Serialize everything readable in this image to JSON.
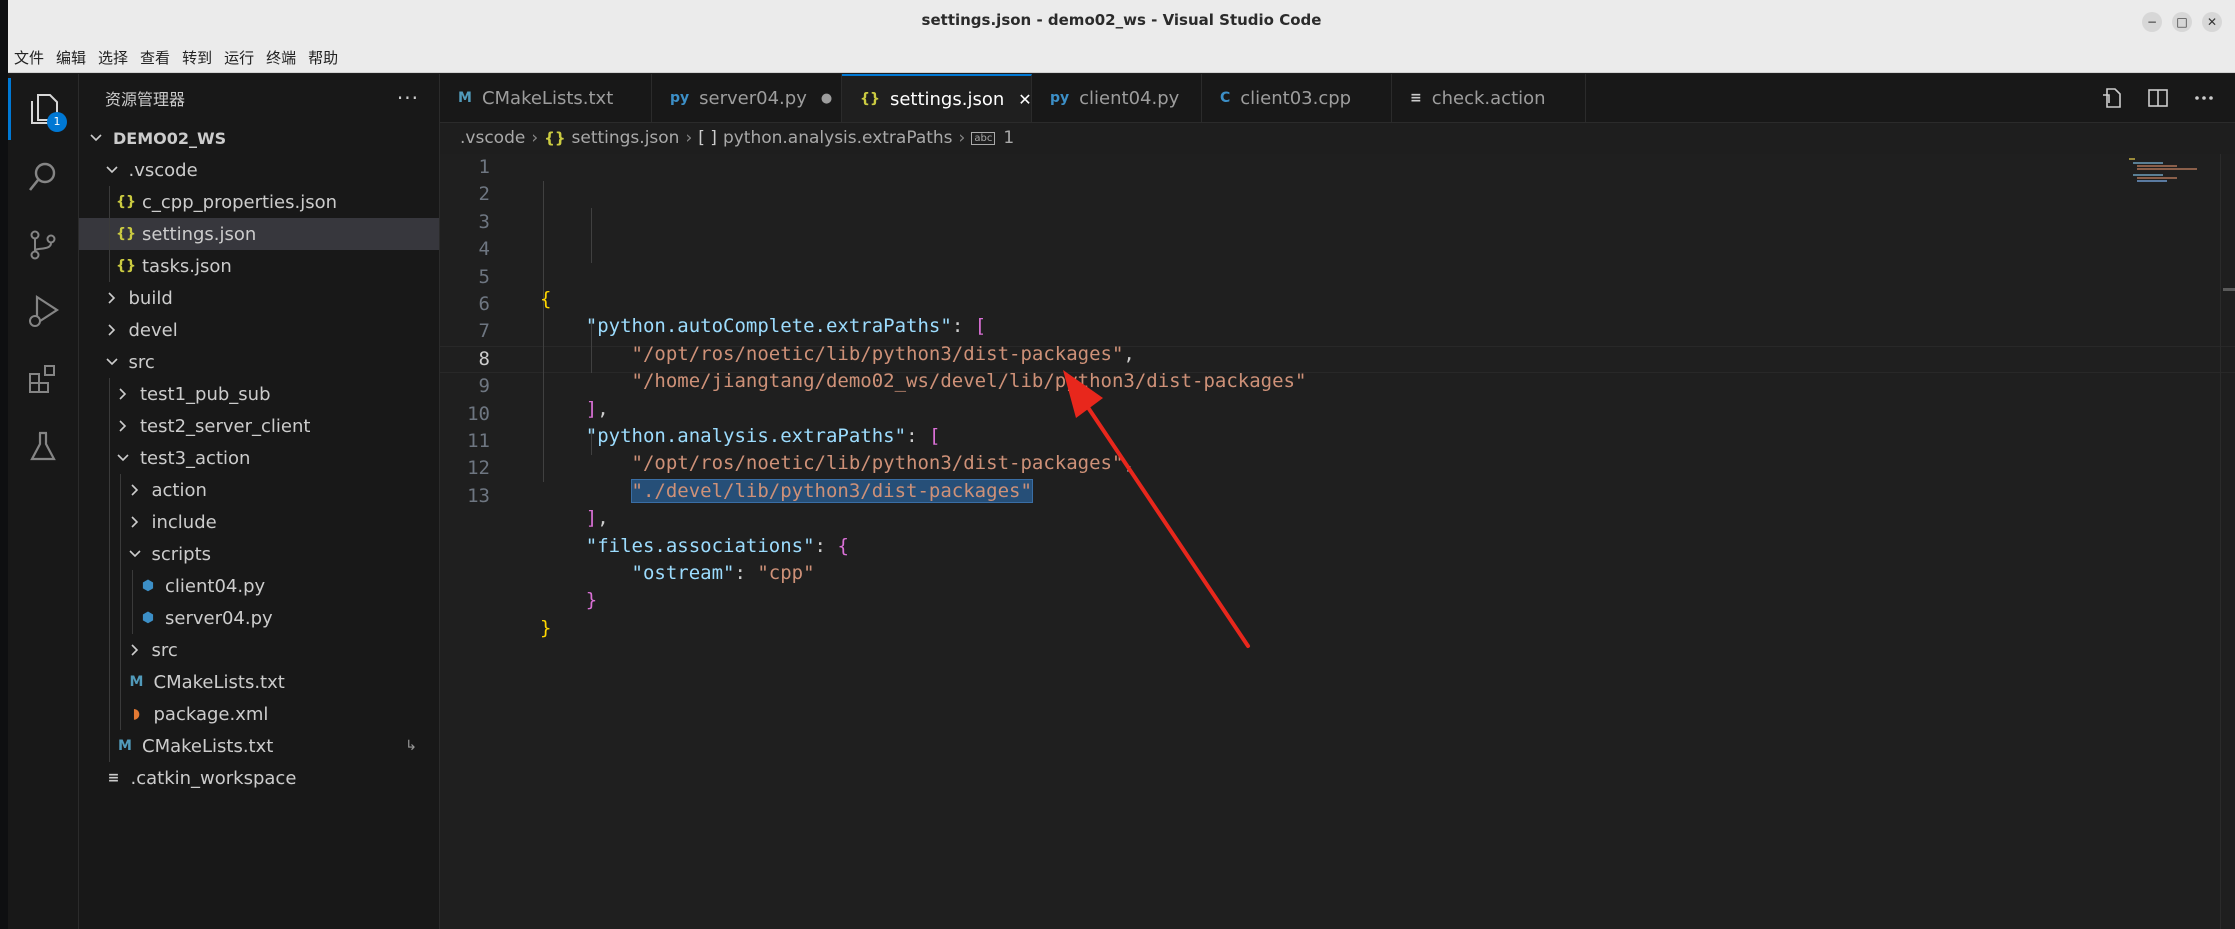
{
  "window": {
    "title": "settings.json - demo02_ws - Visual Studio Code",
    "controls": [
      "−",
      "□",
      "✕"
    ]
  },
  "menu": [
    "文件",
    "编辑",
    "选择",
    "查看",
    "转到",
    "运行",
    "终端",
    "帮助"
  ],
  "activity_bar": {
    "explorer_badge": "1",
    "items": [
      "explorer-icon",
      "search-icon",
      "source-control-icon",
      "run-debug-icon",
      "extensions-icon",
      "testing-icon"
    ]
  },
  "sidebar": {
    "title": "资源管理器",
    "more": "···",
    "tree": [
      {
        "label": "DEMO02_WS",
        "indent": 0,
        "type": "root",
        "chevron": "down"
      },
      {
        "label": ".vscode",
        "indent": 1,
        "type": "folder",
        "chevron": "down"
      },
      {
        "label": "c_cpp_properties.json",
        "indent": 2,
        "type": "json"
      },
      {
        "label": "settings.json",
        "indent": 2,
        "type": "json",
        "selected": true
      },
      {
        "label": "tasks.json",
        "indent": 2,
        "type": "json"
      },
      {
        "label": "build",
        "indent": 1,
        "type": "folder",
        "chevron": "right"
      },
      {
        "label": "devel",
        "indent": 1,
        "type": "folder",
        "chevron": "right"
      },
      {
        "label": "src",
        "indent": 1,
        "type": "folder",
        "chevron": "down"
      },
      {
        "label": "test1_pub_sub",
        "indent": 2,
        "type": "folder",
        "chevron": "right"
      },
      {
        "label": "test2_server_client",
        "indent": 2,
        "type": "folder",
        "chevron": "right"
      },
      {
        "label": "test3_action",
        "indent": 2,
        "type": "folder",
        "chevron": "down"
      },
      {
        "label": "action",
        "indent": 3,
        "type": "folder",
        "chevron": "right"
      },
      {
        "label": "include",
        "indent": 3,
        "type": "folder",
        "chevron": "right"
      },
      {
        "label": "scripts",
        "indent": 3,
        "type": "folder",
        "chevron": "down"
      },
      {
        "label": "client04.py",
        "indent": 4,
        "type": "py"
      },
      {
        "label": "server04.py",
        "indent": 4,
        "type": "py"
      },
      {
        "label": "src",
        "indent": 3,
        "type": "folder",
        "chevron": "right"
      },
      {
        "label": "CMakeLists.txt",
        "indent": 3,
        "type": "m"
      },
      {
        "label": "package.xml",
        "indent": 3,
        "type": "rss"
      },
      {
        "label": "CMakeLists.txt",
        "indent": 2,
        "type": "m",
        "extra": "↳"
      },
      {
        "label": ".catkin_workspace",
        "indent": 1,
        "type": "txt"
      }
    ]
  },
  "tabs": [
    {
      "label": "CMakeLists.txt",
      "icon": "M",
      "icon_type": "m",
      "width": 212
    },
    {
      "label": "server04.py",
      "icon": "py",
      "icon_type": "py",
      "dirty": true,
      "width": 190
    },
    {
      "label": "settings.json",
      "icon": "{}",
      "icon_type": "json",
      "active": true,
      "width": 190
    },
    {
      "label": "client04.py",
      "icon": "py",
      "icon_type": "py",
      "width": 170
    },
    {
      "label": "client03.cpp",
      "icon": "C",
      "icon_type": "py",
      "width": 190
    },
    {
      "label": "check.action",
      "icon": "≡",
      "icon_type": "txt",
      "width": 194
    }
  ],
  "breadcrumb": {
    "folder": ".vscode",
    "file": "settings.json",
    "key_icon": "[ ]",
    "key": "python.analysis.extraPaths",
    "value_icon": "abc",
    "value": "1"
  },
  "editor": {
    "current_line": 8,
    "lines": [
      [
        [
          "b1",
          "{"
        ]
      ],
      [
        [
          "p",
          "    "
        ],
        [
          "key",
          "\"python.autoComplete.extraPaths\""
        ],
        [
          "p",
          ": "
        ],
        [
          "b2",
          "["
        ]
      ],
      [
        [
          "p",
          "        "
        ],
        [
          "str",
          "\"/opt/ros/noetic/lib/python3/dist-packages\""
        ],
        [
          "p",
          ","
        ]
      ],
      [
        [
          "p",
          "        "
        ],
        [
          "str",
          "\"/home/jiangtang/demo02_ws/devel/lib/python3/dist-packages\""
        ]
      ],
      [
        [
          "p",
          "    "
        ],
        [
          "b2",
          "]"
        ],
        [
          "p",
          ","
        ]
      ],
      [
        [
          "p",
          "    "
        ],
        [
          "key",
          "\"python.analysis.extraPaths\""
        ],
        [
          "p",
          ": "
        ],
        [
          "b2",
          "["
        ]
      ],
      [
        [
          "p",
          "        "
        ],
        [
          "str",
          "\"/opt/ros/noetic/lib/python3/dist-packages\""
        ],
        [
          "p",
          ","
        ]
      ],
      [
        [
          "p",
          "        "
        ],
        [
          "str sel",
          "\"./devel/lib/python3/dist-packages\""
        ]
      ],
      [
        [
          "p",
          "    "
        ],
        [
          "b2",
          "]"
        ],
        [
          "p",
          ","
        ]
      ],
      [
        [
          "p",
          "    "
        ],
        [
          "key",
          "\"files.associations\""
        ],
        [
          "p",
          ": "
        ],
        [
          "b2",
          "{"
        ]
      ],
      [
        [
          "p",
          "        "
        ],
        [
          "key",
          "\"ostream\""
        ],
        [
          "p",
          ": "
        ],
        [
          "str",
          "\"cpp\""
        ]
      ],
      [
        [
          "p",
          "    "
        ],
        [
          "b2",
          "}"
        ]
      ],
      [
        [
          "b1",
          "}"
        ]
      ]
    ]
  },
  "colors": {
    "accent": "#0078d4",
    "arrow": "#e8271c",
    "selection": "#264f78"
  }
}
